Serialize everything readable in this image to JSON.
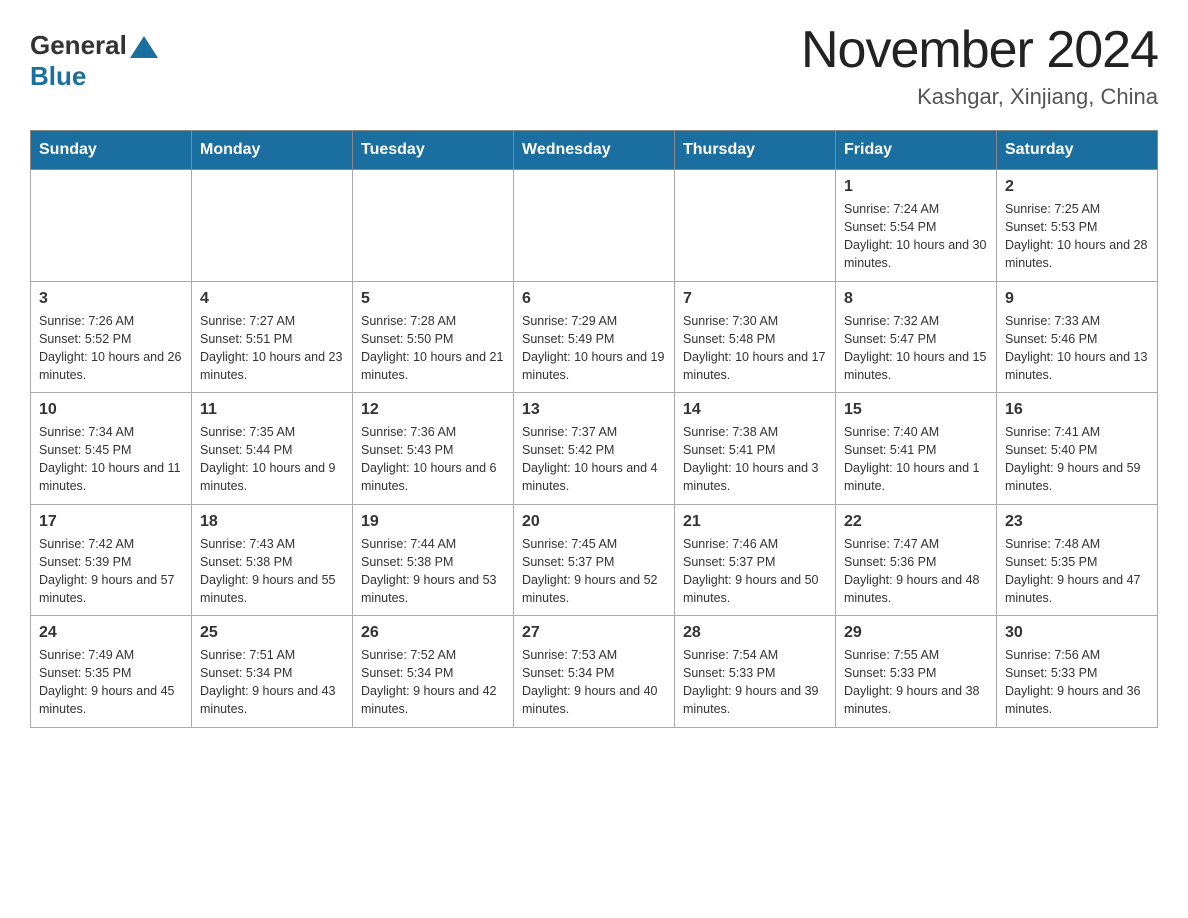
{
  "header": {
    "logo_general": "General",
    "logo_blue": "Blue",
    "month_title": "November 2024",
    "location": "Kashgar, Xinjiang, China"
  },
  "weekdays": [
    "Sunday",
    "Monday",
    "Tuesday",
    "Wednesday",
    "Thursday",
    "Friday",
    "Saturday"
  ],
  "weeks": [
    [
      {
        "day": "",
        "info": ""
      },
      {
        "day": "",
        "info": ""
      },
      {
        "day": "",
        "info": ""
      },
      {
        "day": "",
        "info": ""
      },
      {
        "day": "",
        "info": ""
      },
      {
        "day": "1",
        "info": "Sunrise: 7:24 AM\nSunset: 5:54 PM\nDaylight: 10 hours and 30 minutes."
      },
      {
        "day": "2",
        "info": "Sunrise: 7:25 AM\nSunset: 5:53 PM\nDaylight: 10 hours and 28 minutes."
      }
    ],
    [
      {
        "day": "3",
        "info": "Sunrise: 7:26 AM\nSunset: 5:52 PM\nDaylight: 10 hours and 26 minutes."
      },
      {
        "day": "4",
        "info": "Sunrise: 7:27 AM\nSunset: 5:51 PM\nDaylight: 10 hours and 23 minutes."
      },
      {
        "day": "5",
        "info": "Sunrise: 7:28 AM\nSunset: 5:50 PM\nDaylight: 10 hours and 21 minutes."
      },
      {
        "day": "6",
        "info": "Sunrise: 7:29 AM\nSunset: 5:49 PM\nDaylight: 10 hours and 19 minutes."
      },
      {
        "day": "7",
        "info": "Sunrise: 7:30 AM\nSunset: 5:48 PM\nDaylight: 10 hours and 17 minutes."
      },
      {
        "day": "8",
        "info": "Sunrise: 7:32 AM\nSunset: 5:47 PM\nDaylight: 10 hours and 15 minutes."
      },
      {
        "day": "9",
        "info": "Sunrise: 7:33 AM\nSunset: 5:46 PM\nDaylight: 10 hours and 13 minutes."
      }
    ],
    [
      {
        "day": "10",
        "info": "Sunrise: 7:34 AM\nSunset: 5:45 PM\nDaylight: 10 hours and 11 minutes."
      },
      {
        "day": "11",
        "info": "Sunrise: 7:35 AM\nSunset: 5:44 PM\nDaylight: 10 hours and 9 minutes."
      },
      {
        "day": "12",
        "info": "Sunrise: 7:36 AM\nSunset: 5:43 PM\nDaylight: 10 hours and 6 minutes."
      },
      {
        "day": "13",
        "info": "Sunrise: 7:37 AM\nSunset: 5:42 PM\nDaylight: 10 hours and 4 minutes."
      },
      {
        "day": "14",
        "info": "Sunrise: 7:38 AM\nSunset: 5:41 PM\nDaylight: 10 hours and 3 minutes."
      },
      {
        "day": "15",
        "info": "Sunrise: 7:40 AM\nSunset: 5:41 PM\nDaylight: 10 hours and 1 minute."
      },
      {
        "day": "16",
        "info": "Sunrise: 7:41 AM\nSunset: 5:40 PM\nDaylight: 9 hours and 59 minutes."
      }
    ],
    [
      {
        "day": "17",
        "info": "Sunrise: 7:42 AM\nSunset: 5:39 PM\nDaylight: 9 hours and 57 minutes."
      },
      {
        "day": "18",
        "info": "Sunrise: 7:43 AM\nSunset: 5:38 PM\nDaylight: 9 hours and 55 minutes."
      },
      {
        "day": "19",
        "info": "Sunrise: 7:44 AM\nSunset: 5:38 PM\nDaylight: 9 hours and 53 minutes."
      },
      {
        "day": "20",
        "info": "Sunrise: 7:45 AM\nSunset: 5:37 PM\nDaylight: 9 hours and 52 minutes."
      },
      {
        "day": "21",
        "info": "Sunrise: 7:46 AM\nSunset: 5:37 PM\nDaylight: 9 hours and 50 minutes."
      },
      {
        "day": "22",
        "info": "Sunrise: 7:47 AM\nSunset: 5:36 PM\nDaylight: 9 hours and 48 minutes."
      },
      {
        "day": "23",
        "info": "Sunrise: 7:48 AM\nSunset: 5:35 PM\nDaylight: 9 hours and 47 minutes."
      }
    ],
    [
      {
        "day": "24",
        "info": "Sunrise: 7:49 AM\nSunset: 5:35 PM\nDaylight: 9 hours and 45 minutes."
      },
      {
        "day": "25",
        "info": "Sunrise: 7:51 AM\nSunset: 5:34 PM\nDaylight: 9 hours and 43 minutes."
      },
      {
        "day": "26",
        "info": "Sunrise: 7:52 AM\nSunset: 5:34 PM\nDaylight: 9 hours and 42 minutes."
      },
      {
        "day": "27",
        "info": "Sunrise: 7:53 AM\nSunset: 5:34 PM\nDaylight: 9 hours and 40 minutes."
      },
      {
        "day": "28",
        "info": "Sunrise: 7:54 AM\nSunset: 5:33 PM\nDaylight: 9 hours and 39 minutes."
      },
      {
        "day": "29",
        "info": "Sunrise: 7:55 AM\nSunset: 5:33 PM\nDaylight: 9 hours and 38 minutes."
      },
      {
        "day": "30",
        "info": "Sunrise: 7:56 AM\nSunset: 5:33 PM\nDaylight: 9 hours and 36 minutes."
      }
    ]
  ]
}
